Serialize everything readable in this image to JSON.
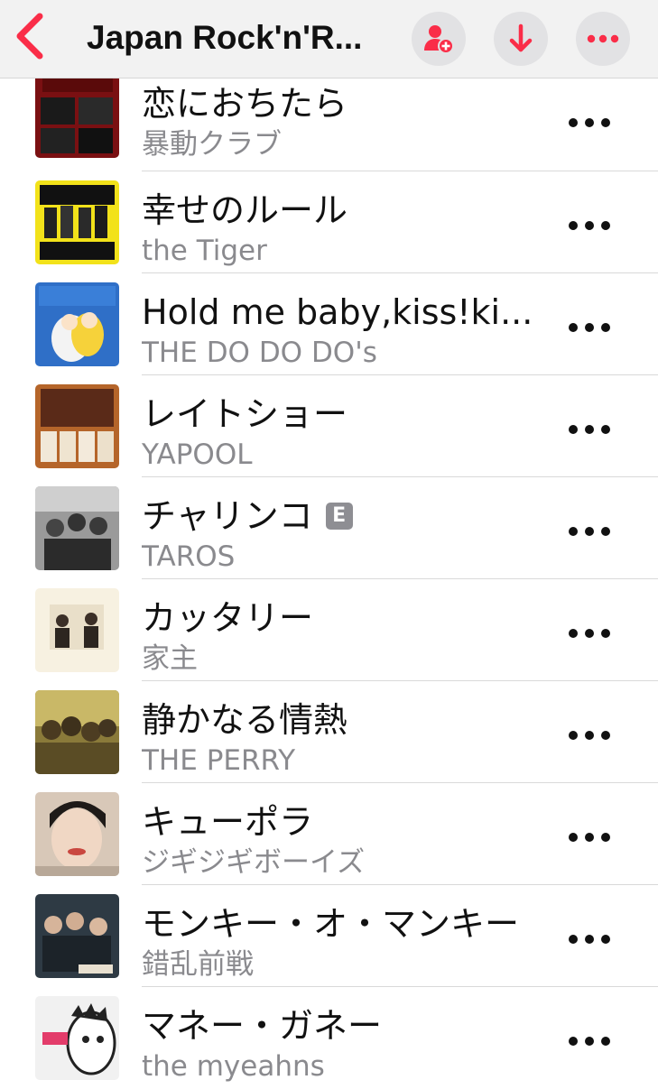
{
  "nav": {
    "title": "Japan Rock'n'R...",
    "accent": "#fa2d48",
    "icons": {
      "back": "chevron-left-icon",
      "add_user": "person-plus-icon",
      "download": "arrow-down-icon",
      "more": "ellipsis-icon"
    }
  },
  "tracks": [
    {
      "title": "恋におちたら",
      "artist": "暴動クラブ",
      "explicit": false
    },
    {
      "title": "幸せのルール",
      "artist": "the Tiger",
      "explicit": false
    },
    {
      "title": "Hold me baby,kiss!ki...",
      "artist": "THE DO DO DO's",
      "explicit": false
    },
    {
      "title": "レイトショー",
      "artist": "YAPOOL",
      "explicit": false
    },
    {
      "title": "チャリンコ",
      "artist": "TAROS",
      "explicit": true,
      "badge": "E"
    },
    {
      "title": "カッタリー",
      "artist": "家主",
      "explicit": false
    },
    {
      "title": "静かなる情熱",
      "artist": "THE PERRY",
      "explicit": false
    },
    {
      "title": "キューポラ",
      "artist": "ジギジギボーイズ",
      "explicit": false
    },
    {
      "title": "モンキー・オ・マンキー",
      "artist": "錯乱前戦",
      "explicit": false
    },
    {
      "title": "マネー・ガネー",
      "artist": "the myeahns",
      "explicit": false
    }
  ]
}
